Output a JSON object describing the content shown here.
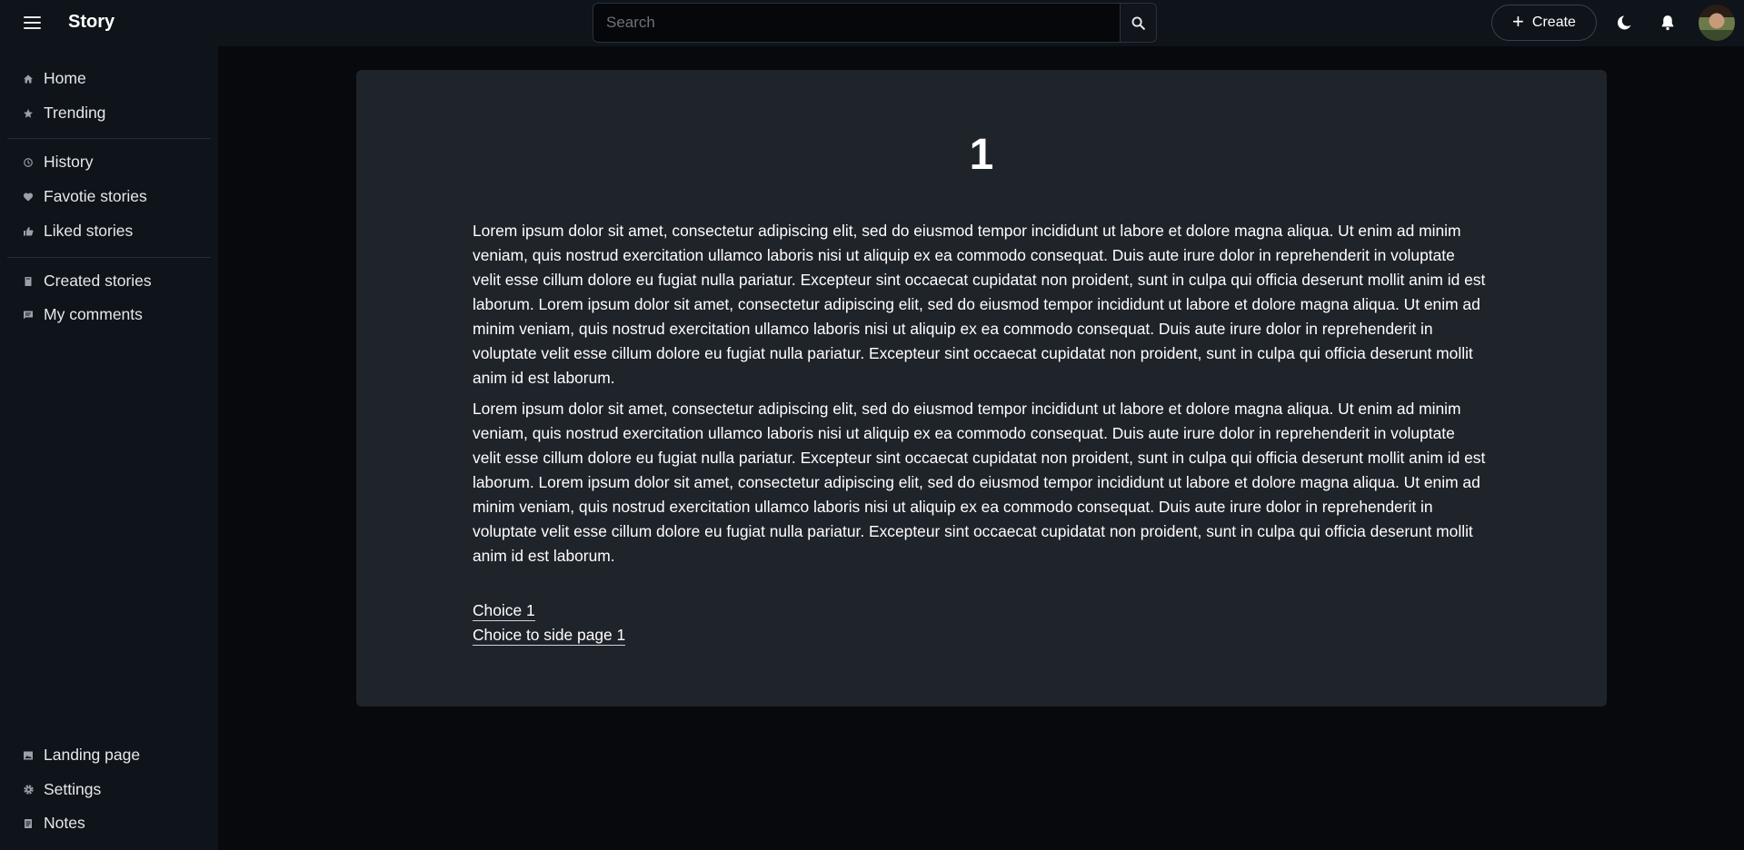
{
  "app": {
    "title": "Story"
  },
  "search": {
    "placeholder": "Search"
  },
  "header": {
    "create_label": "Create"
  },
  "sidebar": {
    "group1": [
      {
        "label": "Home",
        "icon": "home-icon"
      },
      {
        "label": "Trending",
        "icon": "star-icon"
      }
    ],
    "group2": [
      {
        "label": "History",
        "icon": "history-icon"
      },
      {
        "label": "Favotie stories",
        "icon": "heart-icon"
      },
      {
        "label": "Liked stories",
        "icon": "thumbs-up-icon"
      }
    ],
    "group3": [
      {
        "label": "Created stories",
        "icon": "book-icon"
      },
      {
        "label": "My comments",
        "icon": "comment-icon"
      }
    ],
    "bottom": [
      {
        "label": "Landing page",
        "icon": "image-icon"
      },
      {
        "label": "Settings",
        "icon": "gear-icon"
      },
      {
        "label": "Notes",
        "icon": "notes-icon"
      }
    ]
  },
  "story": {
    "page_number": "1",
    "paragraphs": [
      "Lorem ipsum dolor sit amet, consectetur adipiscing elit, sed do eiusmod tempor incididunt ut labore et dolore magna aliqua. Ut enim ad minim veniam, quis nostrud exercitation ullamco laboris nisi ut aliquip ex ea commodo consequat. Duis aute irure dolor in reprehenderit in voluptate velit esse cillum dolore eu fugiat nulla pariatur. Excepteur sint occaecat cupidatat non proident, sunt in culpa qui officia deserunt mollit anim id est laborum. Lorem ipsum dolor sit amet, consectetur adipiscing elit, sed do eiusmod tempor incididunt ut labore et dolore magna aliqua. Ut enim ad minim veniam, quis nostrud exercitation ullamco laboris nisi ut aliquip ex ea commodo consequat. Duis aute irure dolor in reprehenderit in voluptate velit esse cillum dolore eu fugiat nulla pariatur. Excepteur sint occaecat cupidatat non proident, sunt in culpa qui officia deserunt mollit anim id est laborum.",
      "Lorem ipsum dolor sit amet, consectetur adipiscing elit, sed do eiusmod tempor incididunt ut labore et dolore magna aliqua. Ut enim ad minim veniam, quis nostrud exercitation ullamco laboris nisi ut aliquip ex ea commodo consequat. Duis aute irure dolor in reprehenderit in voluptate velit esse cillum dolore eu fugiat nulla pariatur. Excepteur sint occaecat cupidatat non proident, sunt in culpa qui officia deserunt mollit anim id est laborum. Lorem ipsum dolor sit amet, consectetur adipiscing elit, sed do eiusmod tempor incididunt ut labore et dolore magna aliqua. Ut enim ad minim veniam, quis nostrud exercitation ullamco laboris nisi ut aliquip ex ea commodo consequat. Duis aute irure dolor in reprehenderit in voluptate velit esse cillum dolore eu fugiat nulla pariatur. Excepteur sint occaecat cupidatat non proident, sunt in culpa qui officia deserunt mollit anim id est laborum."
    ],
    "choices": [
      "Choice 1",
      "Choice to side page 1"
    ]
  },
  "colors": {
    "background": "#07090c",
    "panel": "#0f131a",
    "card": "#1f232a",
    "text": "#ffffff"
  }
}
